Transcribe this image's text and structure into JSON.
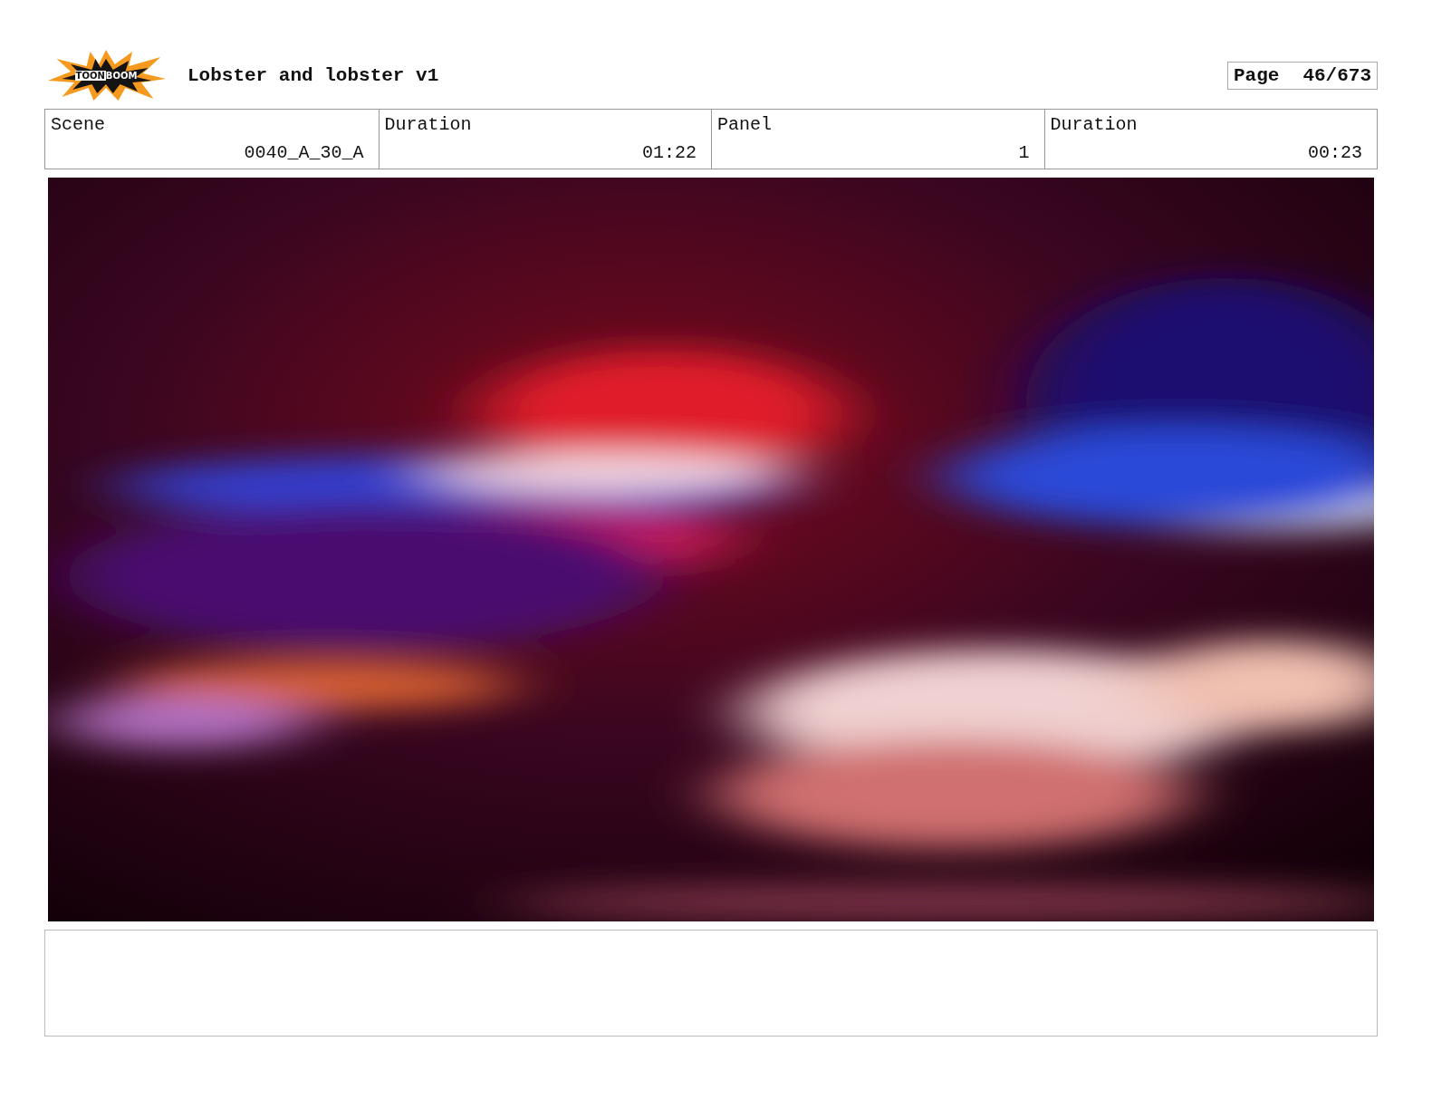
{
  "logo": {
    "words": [
      "TOON",
      "BOOM"
    ]
  },
  "title": "Lobster and lobster v1",
  "page": {
    "label": "Page",
    "value": "46/673"
  },
  "fields": [
    {
      "label": "Scene",
      "value": "0040_A_30_A"
    },
    {
      "label": "Duration",
      "value": "01:22"
    },
    {
      "label": "Panel",
      "value": "1"
    },
    {
      "label": "Duration",
      "value": "00:23"
    }
  ]
}
